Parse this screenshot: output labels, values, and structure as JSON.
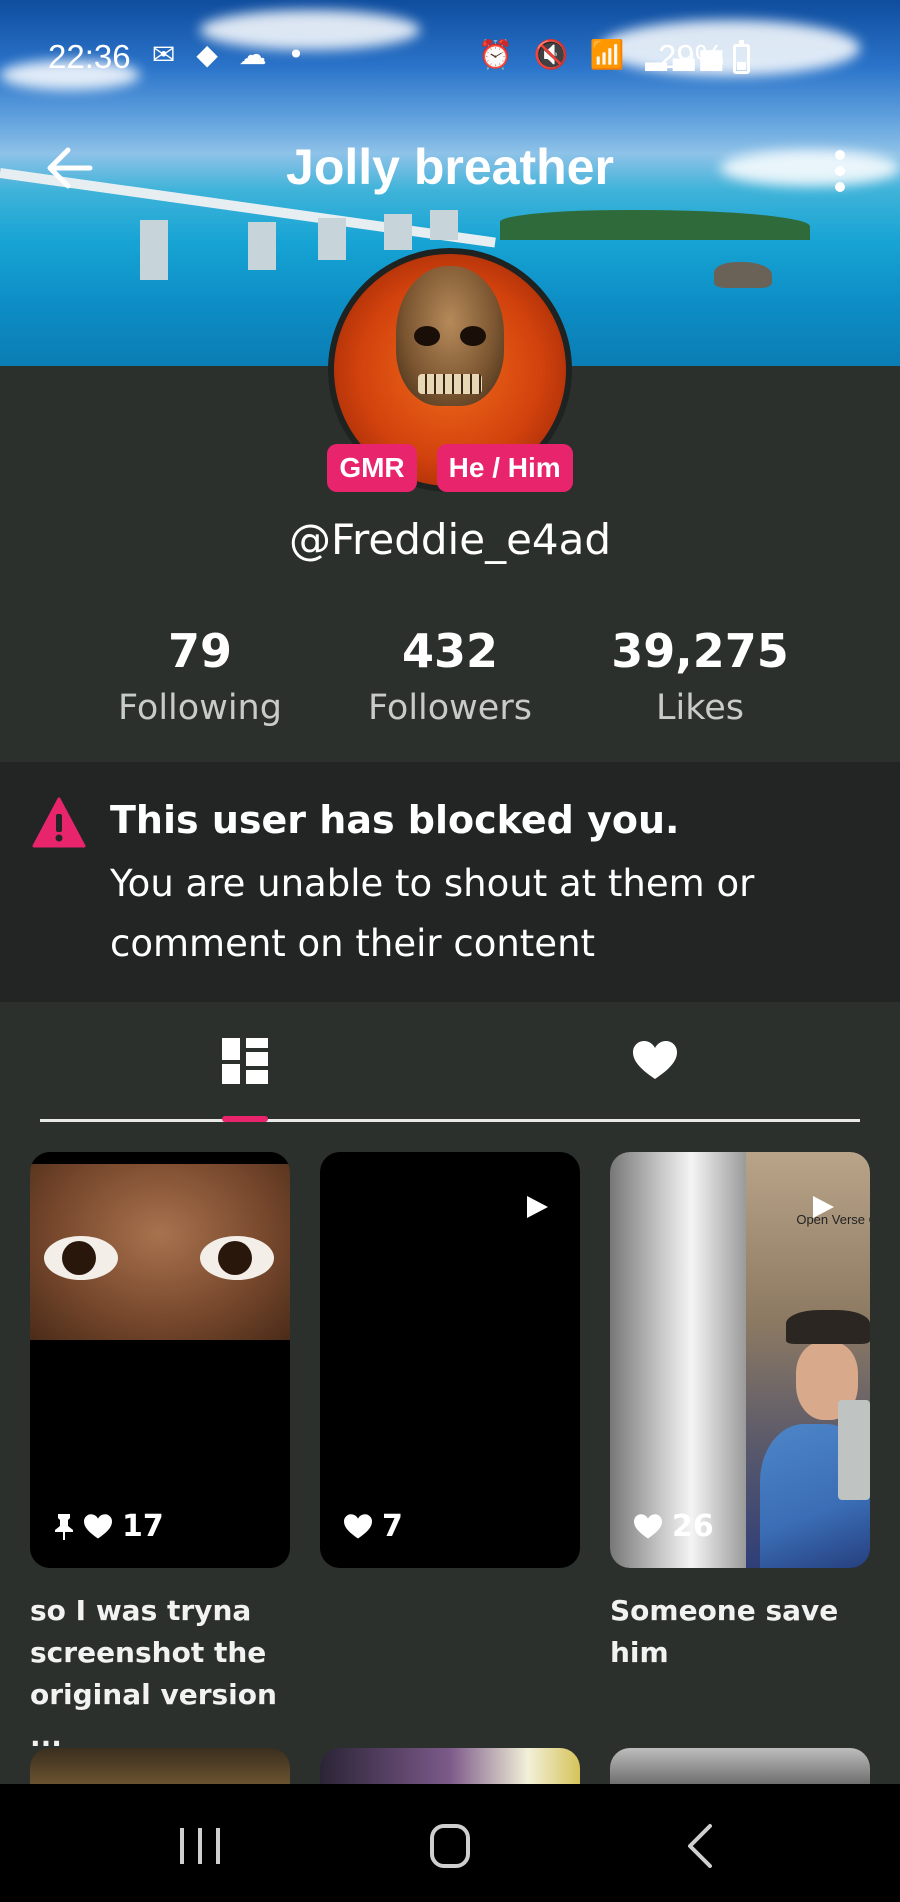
{
  "status_bar": {
    "time": "22:36",
    "left_icons": "✉ ◆ ☁ •",
    "right_icons": "⏰ 🔇 📶 ▂▃▅",
    "battery_percent": "29%"
  },
  "header": {
    "title": "Jolly breather",
    "back_icon": "arrow-left-icon",
    "more_icon": "more-vertical-icon"
  },
  "profile": {
    "badges": [
      "GMR",
      "He / Him"
    ],
    "username": "@Freddie_e4ad",
    "stats": [
      {
        "value": "79",
        "label": "Following"
      },
      {
        "value": "432",
        "label": "Followers"
      },
      {
        "value": "39,275",
        "label": "Likes"
      }
    ]
  },
  "blocked_notice": {
    "title": "This user has blocked you.",
    "body": "You are unable to shout at them or comment on their content",
    "icon": "warning-icon",
    "accent": "#e8246d"
  },
  "tabs": [
    {
      "icon": "grid-icon",
      "active": true
    },
    {
      "icon": "heart-icon",
      "active": false
    }
  ],
  "posts": [
    {
      "likes": "17",
      "pinned": true,
      "caption": "so I was tryna screenshot the original version ..."
    },
    {
      "likes": "7",
      "pinned": false,
      "caption": ""
    },
    {
      "likes": "26",
      "pinned": false,
      "caption": "Someone save him",
      "overlay_text": "Open Verse C"
    }
  ],
  "nav_bar": {
    "icons": [
      "recent-apps-icon",
      "home-icon",
      "back-icon"
    ]
  },
  "colors": {
    "accent": "#e8246d",
    "background": "#2c302d",
    "notice_bg": "#222524"
  }
}
